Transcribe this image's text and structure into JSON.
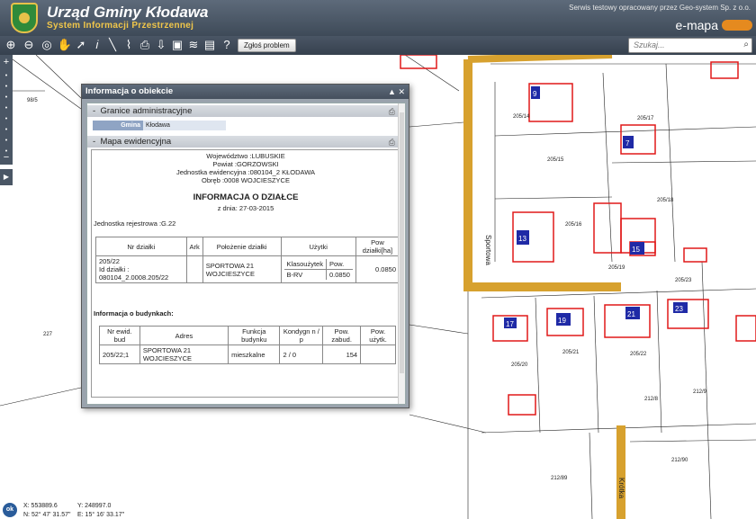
{
  "header": {
    "title": "Urząd Gminy Kłodawa",
    "subtitle": "System Informacji Przestrzennej",
    "vendor_text": "Serwis testowy opracowany przez Geo-system Sp. z o.o.",
    "brand": "e-mapa"
  },
  "toolbar": {
    "report_label": "Zgłoś problem",
    "search_placeholder": "Szukaj..."
  },
  "dialog": {
    "title": "Informacja o obiekcie",
    "section_admin": "Granice administracyjne",
    "gmina_label": "Gmina",
    "gmina_value": "Kłodawa",
    "section_map": "Mapa ewidencyjna",
    "wojewodztwo": "Województwo :LUBUSKIE",
    "powiat": "Powiat :GORZOWSKI",
    "jednostka": "Jednostka ewidencyjna :080104_2 KŁODAWA",
    "obreb": "Obręb :0008 WOJCIESZYCE",
    "heading": "INFORMACJA O DZIAŁCE",
    "date": "z dnia: 27-03-2015",
    "jednostka_rejestrowa": "Jednostka rejestrowa :G.22",
    "parcel_table": {
      "headers": [
        "Nr działki",
        "Ark",
        "Położenie działki",
        "Użytki",
        "Pow działki[ha]"
      ],
      "nr_dzialki": "205/22",
      "id_dzialki": "Id działki : 080104_2.0008.205/22",
      "ark": "",
      "polozenie": "SPORTOWA 21 WOJCIESZYCE",
      "uzytki_headers": [
        "Klasoużytek",
        "Pow."
      ],
      "klasouzytek": "B-RV",
      "uzytek_pow": "0.0850",
      "pow_dzialki": "0.0850"
    },
    "buildings_heading": "Informacja o budynkach:",
    "buildings_table": {
      "headers": [
        "Nr ewid. bud",
        "Adres",
        "Funkcja budynku",
        "Kondygn n / p",
        "Pow. zabud.",
        "Pow. użytk."
      ],
      "rows": [
        {
          "nr": "205/22;1",
          "adres": "SPORTOWA 21 WOJCIESZYCE",
          "funkcja": "mieszkalne",
          "kondygn": "2 / 0",
          "pow_zabud": "154",
          "pow_uzytk": ""
        }
      ]
    }
  },
  "footer": {
    "ok_label": "ok",
    "x_label": "X: 553889.6",
    "y_label": "Y: 248997.0",
    "n_label": "N: 52° 47' 31.57\"",
    "e_label": "E: 15° 16' 33.17\""
  },
  "map_labels": {
    "street_sportowa": "Sportowa",
    "street_bottom": "Krótka",
    "parcels": [
      "98/5",
      "205/14",
      "205/17",
      "205/15",
      "205/16",
      "205/18",
      "205/19",
      "205/23",
      "205/20",
      "205/21",
      "205/22",
      "212/8",
      "212/9",
      "212/90",
      "212/89",
      "227"
    ],
    "building_numbers": [
      "9",
      "7",
      "13",
      "15",
      "17",
      "19",
      "21",
      "23"
    ]
  },
  "colors": {
    "road": "#d7a12e",
    "building": "#e01818",
    "house_number_bg": "#1f2aa6",
    "header_bg": "#4b5766"
  }
}
